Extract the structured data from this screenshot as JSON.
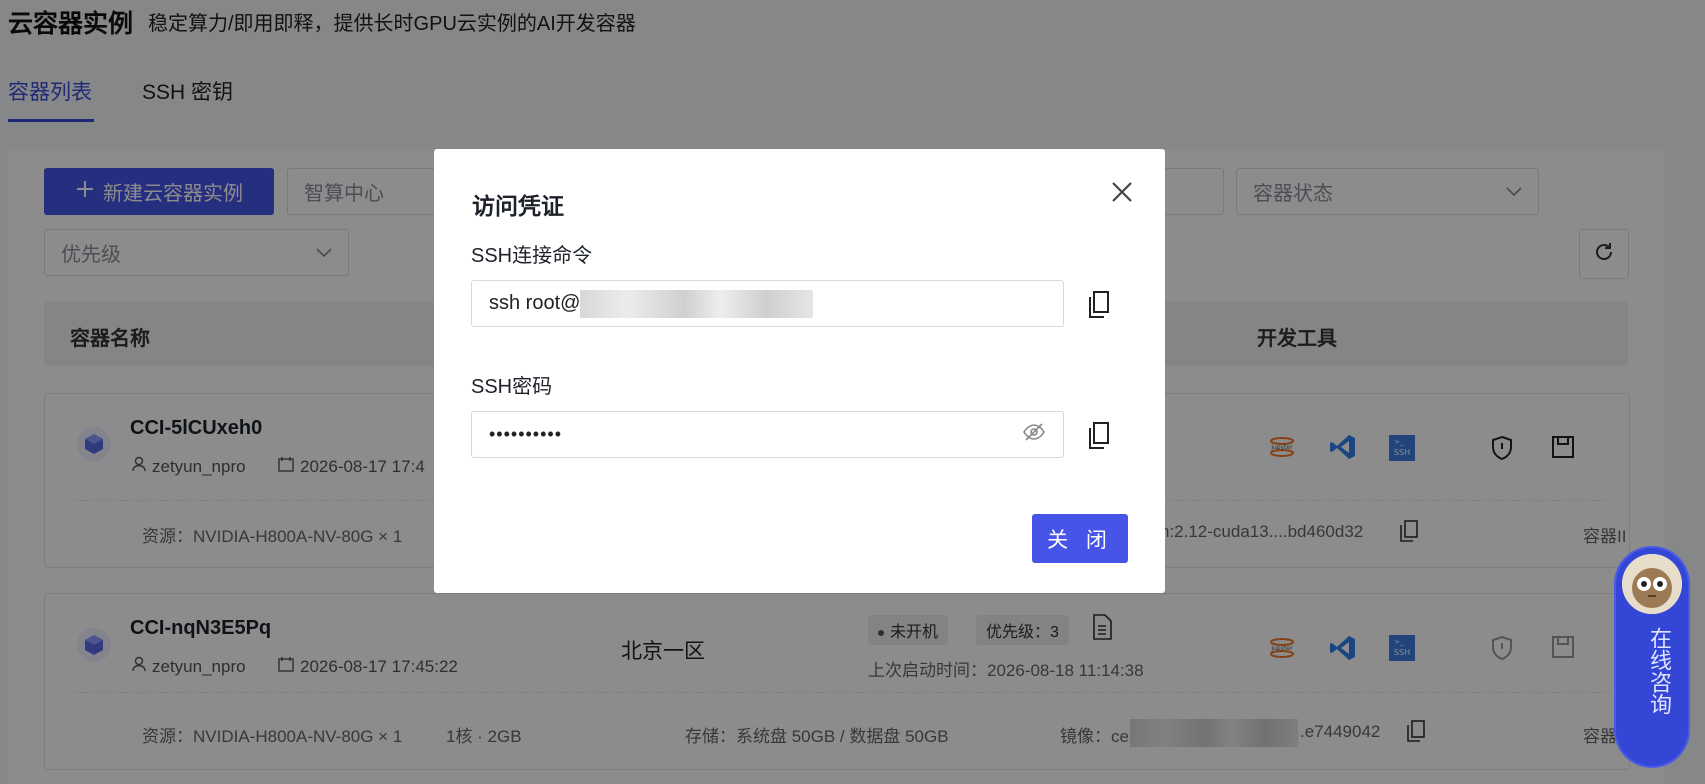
{
  "header": {
    "title": "云容器实例",
    "subtitle": "稳定算力/即用即释，提供长时GPU云实例的AI开发容器"
  },
  "tabs": [
    {
      "label": "容器列表",
      "active": true
    },
    {
      "label": "SSH 密钥",
      "active": false
    }
  ],
  "toolbar": {
    "new_button": "新建云容器实例",
    "filter_center_placeholder": "智算中心",
    "filter_status_placeholder": "容器状态",
    "filter_priority_placeholder": "优先级"
  },
  "table": {
    "headers": [
      "容器名称",
      "开发工具"
    ]
  },
  "rows": [
    {
      "name": "CCI-5lCUxeh0",
      "user": "zetyun_npro",
      "created": "2026-08-17 17:4",
      "resource": "资源：NVIDIA-H800A-NV-80G × 1",
      "image_tail": "h:2.12-cuda13....bd460d32",
      "container_tail": "容器II"
    },
    {
      "name": "CCI-nqN3E5Pq",
      "user": "zetyun_npro",
      "created": "2026-08-17 17:45:22",
      "region": "北京一区",
      "status": "未开机",
      "priority": "优先级：3",
      "last_start": "上次启动时间：2026-08-18 11:14:38",
      "resource": "资源：NVIDIA-H800A-NV-80G × 1",
      "cpu_mem": "1核 · 2GB",
      "storage": "存储：系统盘 50GB  /  数据盘 50GB",
      "image_prefix": "镜像：ce",
      "image_tail": ".e7449042",
      "container_tail": "容器"
    }
  ],
  "modal": {
    "title": "访问凭证",
    "ssh_command_label": "SSH连接命令",
    "ssh_command_value": "ssh root@",
    "ssh_password_label": "SSH密码",
    "ssh_password_masked": "••••••••••",
    "close_button": "关 闭"
  },
  "consult": {
    "label": "在线咨询"
  },
  "colors": {
    "primary": "#4654e8",
    "tab_active": "#3b4cd8",
    "overlay": "rgba(0,0,0,0.45)"
  }
}
